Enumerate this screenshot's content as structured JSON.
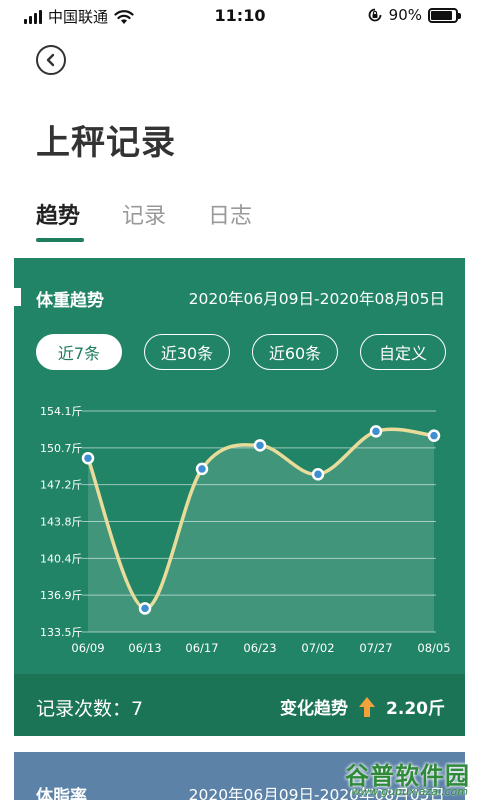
{
  "status": {
    "carrier": "中国联通",
    "time": "11:10",
    "battery": "90%"
  },
  "page_title": "上秤记录",
  "tabs": [
    {
      "label": "趋势",
      "active": true
    },
    {
      "label": "记录",
      "active": false
    },
    {
      "label": "日志",
      "active": false
    }
  ],
  "weight_card": {
    "title": "体重趋势",
    "range": "2020年06月09日-2020年08月05日",
    "filters": [
      {
        "label": "近7条",
        "active": true
      },
      {
        "label": "近30条",
        "active": false
      },
      {
        "label": "近60条",
        "active": false
      },
      {
        "label": "自定义",
        "active": false
      }
    ],
    "count_label": "记录次数：7",
    "trend_label": "变化趋势",
    "trend_value": "2.20斤",
    "colors": {
      "bg": "#218466",
      "line": "#e9dc9a",
      "point": "#3f8fd0"
    }
  },
  "fat_card": {
    "title": "体脂率",
    "range": "2020年06月09日-2020年08月05日"
  },
  "watermark": {
    "title": "谷普软件园",
    "url": "www.gupuxiazai.com"
  },
  "chart_data": {
    "type": "line",
    "x": [
      "06/09",
      "06/13",
      "06/17",
      "06/23",
      "07/02",
      "07/27",
      "08/05"
    ],
    "series": [
      {
        "values": [
          149.7,
          135.7,
          148.7,
          150.9,
          148.2,
          152.2,
          151.8
        ]
      }
    ],
    "y_ticks": [
      "154.1斤",
      "150.7斤",
      "147.2斤",
      "143.8斤",
      "140.4斤",
      "136.9斤",
      "133.5斤"
    ],
    "ylim": [
      133.5,
      154.1
    ],
    "grid": true
  }
}
